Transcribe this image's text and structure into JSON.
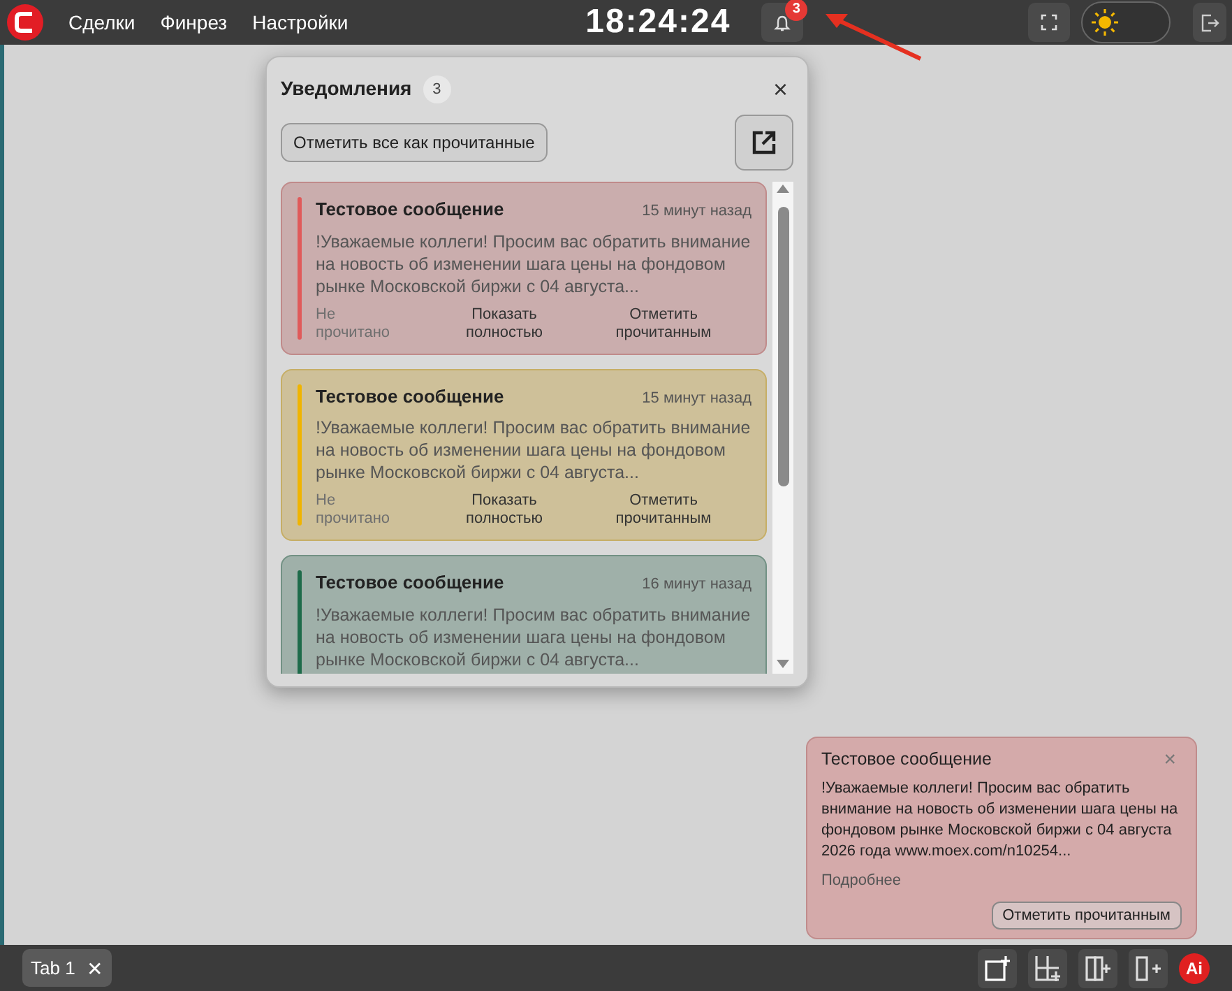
{
  "topbar": {
    "nav": [
      {
        "label": "Сделки"
      },
      {
        "label": "Финрез"
      },
      {
        "label": "Настройки"
      }
    ],
    "clock": "18:24:24",
    "bell_badge": "3",
    "dark_mode": false
  },
  "notifications_panel": {
    "title": "Уведомления",
    "count": "3",
    "close": "×",
    "mark_all_button": "Отметить все как прочитанные",
    "items": [
      {
        "title": "Тестовое сообщение",
        "time": "15 минут назад",
        "body": "!Уважаемые коллеги! Просим вас обратить внимание на новость об изменении шага цены на фондовом рынке Московской биржи с 04 августа...",
        "status": "Не прочитано",
        "show_full": "Показать полностью",
        "mark_read": "Отметить прочитанным",
        "color": "#e05a5a"
      },
      {
        "title": "Тестовое сообщение",
        "time": "15 минут назад",
        "body": "!Уважаемые коллеги! Просим вас обратить внимание на новость об изменении шага цены на фондовом рынке Московской биржи с 04 августа...",
        "status": "Не прочитано",
        "show_full": "Показать полностью",
        "mark_read": "Отметить прочитанным",
        "color": "#f0b400"
      },
      {
        "title": "Тестовое сообщение",
        "time": "16 минут назад",
        "body": "!Уважаемые коллеги! Просим вас обратить внимание на новость об изменении шага цены на фондовом рынке Московской биржи с 04 августа...",
        "color": "#1e6b4a"
      }
    ]
  },
  "toast": {
    "title": "Тестовое сообщение",
    "close": "×",
    "body": "!Уважаемые коллеги! Просим вас обратить внимание на новость об изменении шага цены на фондовом рынке Московской биржи с 04 августа 2026 года www.moex.com/n10254...",
    "more": "Подробнее",
    "button": "Отметить прочитанным"
  },
  "bottom_bar": {
    "tabs": [
      {
        "label": "Tab 1",
        "close": "✕",
        "selected": true
      }
    ],
    "ai_label": "Ai"
  }
}
